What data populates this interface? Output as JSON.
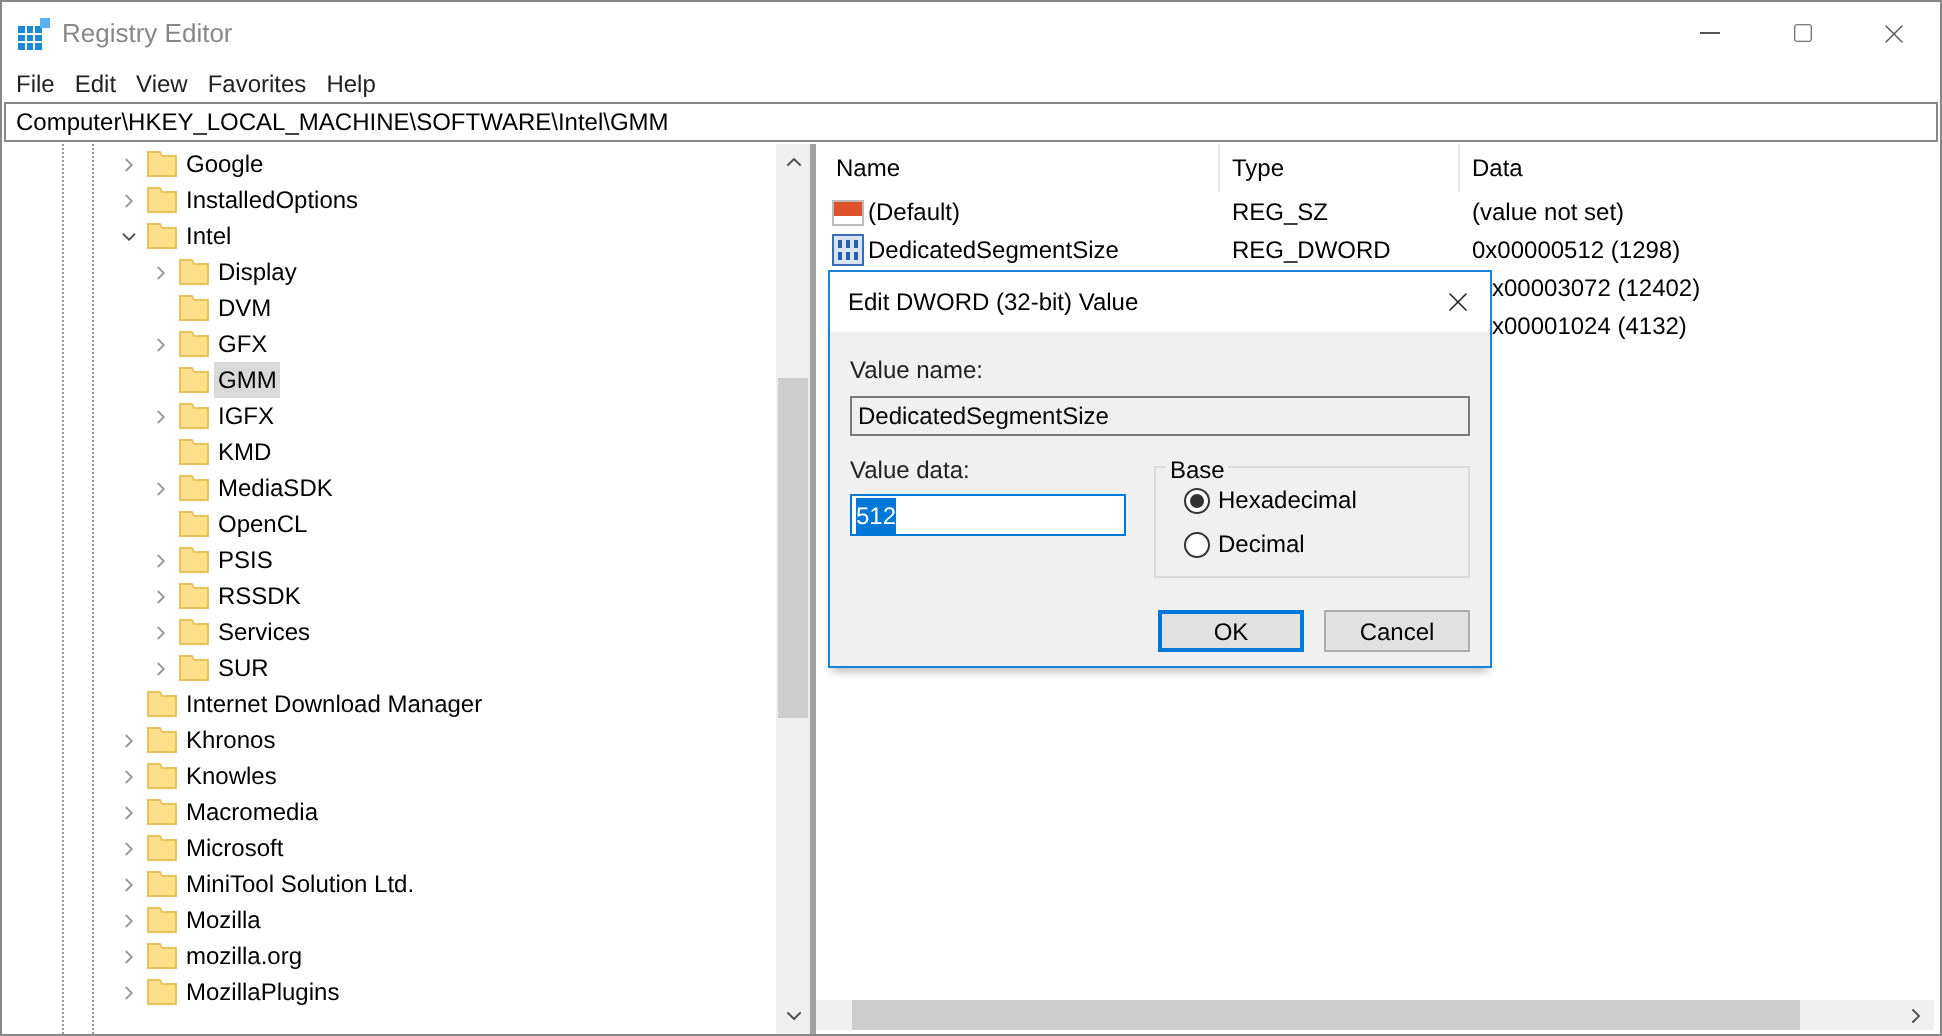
{
  "window": {
    "title": "Registry Editor"
  },
  "menu": [
    "File",
    "Edit",
    "View",
    "Favorites",
    "Help"
  ],
  "address": "Computer\\HKEY_LOCAL_MACHINE\\SOFTWARE\\Intel\\GMM",
  "tree": [
    {
      "label": "Google",
      "expandable": true,
      "expanded": false,
      "selected": false
    },
    {
      "label": "InstalledOptions",
      "expandable": true,
      "expanded": false,
      "selected": false
    },
    {
      "label": "Intel",
      "expandable": true,
      "expanded": true,
      "selected": false,
      "children": [
        {
          "label": "Display",
          "expandable": true,
          "expanded": false,
          "selected": false
        },
        {
          "label": "DVM",
          "expandable": false,
          "expanded": false,
          "selected": false
        },
        {
          "label": "GFX",
          "expandable": true,
          "expanded": false,
          "selected": false
        },
        {
          "label": "GMM",
          "expandable": false,
          "expanded": false,
          "selected": true
        },
        {
          "label": "IGFX",
          "expandable": true,
          "expanded": false,
          "selected": false
        },
        {
          "label": "KMD",
          "expandable": false,
          "expanded": false,
          "selected": false
        },
        {
          "label": "MediaSDK",
          "expandable": true,
          "expanded": false,
          "selected": false
        },
        {
          "label": "OpenCL",
          "expandable": false,
          "expanded": false,
          "selected": false
        },
        {
          "label": "PSIS",
          "expandable": true,
          "expanded": false,
          "selected": false
        },
        {
          "label": "RSSDK",
          "expandable": true,
          "expanded": false,
          "selected": false
        },
        {
          "label": "Services",
          "expandable": true,
          "expanded": false,
          "selected": false
        },
        {
          "label": "SUR",
          "expandable": true,
          "expanded": false,
          "selected": false
        }
      ]
    },
    {
      "label": "Internet Download Manager",
      "expandable": false,
      "expanded": false,
      "selected": false
    },
    {
      "label": "Khronos",
      "expandable": true,
      "expanded": false,
      "selected": false
    },
    {
      "label": "Knowles",
      "expandable": true,
      "expanded": false,
      "selected": false
    },
    {
      "label": "Macromedia",
      "expandable": true,
      "expanded": false,
      "selected": false
    },
    {
      "label": "Microsoft",
      "expandable": true,
      "expanded": false,
      "selected": false
    },
    {
      "label": "MiniTool Solution Ltd.",
      "expandable": true,
      "expanded": false,
      "selected": false
    },
    {
      "label": "Mozilla",
      "expandable": true,
      "expanded": false,
      "selected": false
    },
    {
      "label": "mozilla.org",
      "expandable": true,
      "expanded": false,
      "selected": false
    },
    {
      "label": "MozillaPlugins",
      "expandable": true,
      "expanded": false,
      "selected": false
    }
  ],
  "values": {
    "columns": [
      "Name",
      "Type",
      "Data"
    ],
    "rows": [
      {
        "kind": "string",
        "name": "(Default)",
        "type": "REG_SZ",
        "data": "(value not set)"
      },
      {
        "kind": "dword",
        "name": "DedicatedSegmentSize",
        "type": "REG_DWORD",
        "data": "0x00000512 (1298)"
      },
      {
        "kind": "hidden",
        "data": "x00003072 (12402)"
      },
      {
        "kind": "hidden",
        "data": "x00001024 (4132)"
      }
    ]
  },
  "dialog": {
    "title": "Edit DWORD (32-bit) Value",
    "name_label": "Value name:",
    "name_value": "DedicatedSegmentSize",
    "data_label": "Value data:",
    "data_value": "512",
    "base_label": "Base",
    "base_options": [
      {
        "label": "Hexadecimal",
        "selected": true
      },
      {
        "label": "Decimal",
        "selected": false
      }
    ],
    "buttons": [
      "OK",
      "Cancel"
    ]
  }
}
